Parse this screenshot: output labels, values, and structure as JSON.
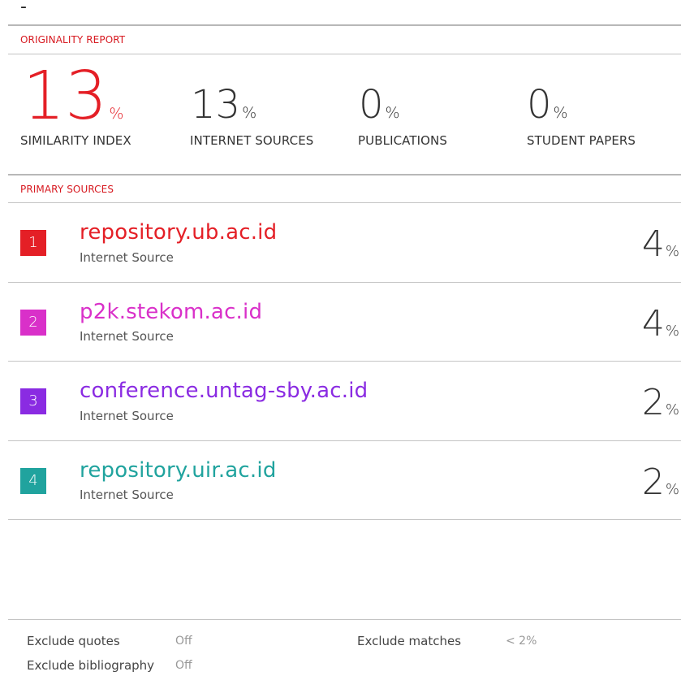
{
  "header": {
    "dash": "-",
    "originality_label": "ORIGINALITY REPORT"
  },
  "stats": [
    {
      "value": "13",
      "unit": "%",
      "label": "SIMILARITY INDEX",
      "color": "#e41f26"
    },
    {
      "value": "13",
      "unit": "%",
      "label": "INTERNET SOURCES",
      "color": "#333333"
    },
    {
      "value": "0",
      "unit": "%",
      "label": "PUBLICATIONS",
      "color": "#333333"
    },
    {
      "value": "0",
      "unit": "%",
      "label": "STUDENT PAPERS",
      "color": "#333333"
    }
  ],
  "primary_sources_label": "PRIMARY SOURCES",
  "sources": [
    {
      "rank": "1",
      "name": "repository.ub.ac.id",
      "type": "Internet Source",
      "value": "4",
      "unit": "%",
      "color": "#e41f26"
    },
    {
      "rank": "2",
      "name": "p2k.stekom.ac.id",
      "type": "Internet Source",
      "value": "4",
      "unit": "%",
      "color": "#d930c9"
    },
    {
      "rank": "3",
      "name": "conference.untag-sby.ac.id",
      "type": "Internet Source",
      "value": "2",
      "unit": "%",
      "color": "#8a2be2"
    },
    {
      "rank": "4",
      "name": "repository.uir.ac.id",
      "type": "Internet Source",
      "value": "2",
      "unit": "%",
      "color": "#20a39e"
    }
  ],
  "footer": {
    "exclude_quotes_label": "Exclude quotes",
    "exclude_quotes_value": "Off",
    "exclude_bibliography_label": "Exclude bibliography",
    "exclude_bibliography_value": "Off",
    "exclude_matches_label": "Exclude matches",
    "exclude_matches_value": "< 2%"
  }
}
